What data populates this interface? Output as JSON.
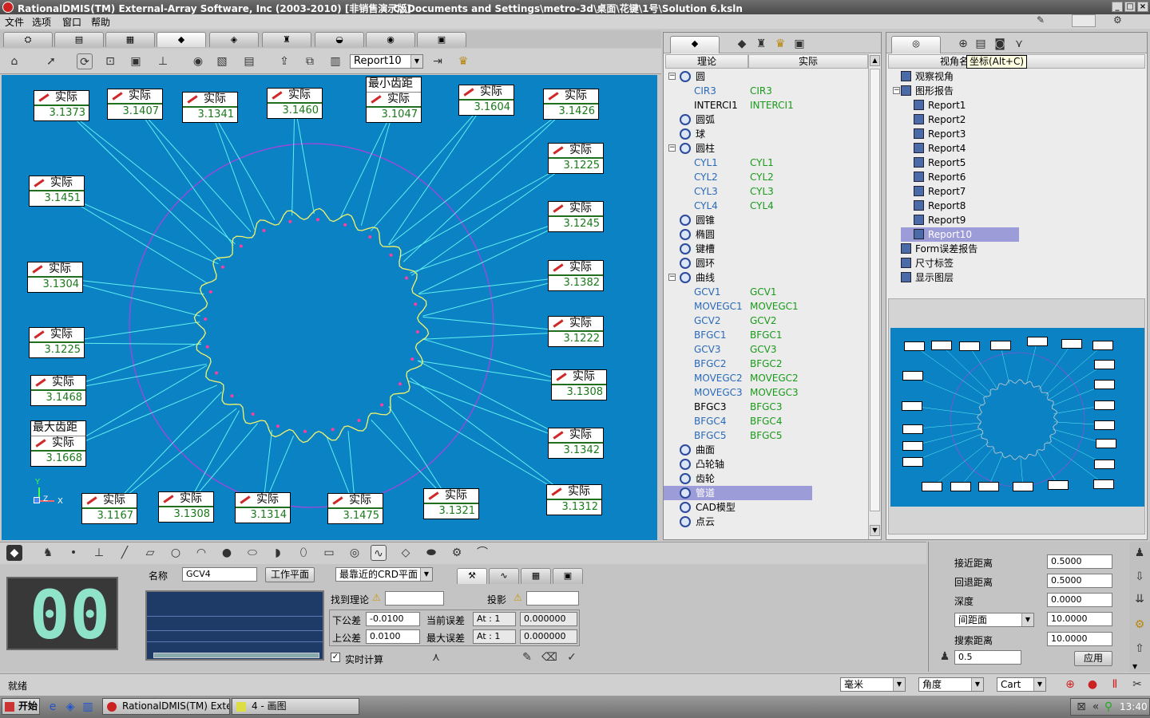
{
  "window": {
    "title": "RationalDMIS(TM) External-Array Software, Inc (2003-2010) [非销售演示版]",
    "path": "C:\\Documents and Settings\\metro-3d\\桌面\\花键\\1号\\Solution 6.ksln"
  },
  "menu": [
    "文件",
    "选项",
    "窗口",
    "帮助"
  ],
  "toolbar": {
    "report_select": "Report10"
  },
  "labels": [
    {
      "h": "实际",
      "v": "3.1373"
    },
    {
      "h": "实际",
      "v": "3.1407"
    },
    {
      "h": "实际",
      "v": "3.1341"
    },
    {
      "h": "实际",
      "v": "3.1460"
    },
    {
      "h0": "最小齿距",
      "h": "实际",
      "v": "3.1047"
    },
    {
      "h": "实际",
      "v": "3.1604"
    },
    {
      "h": "实际",
      "v": "3.1426"
    },
    {
      "h": "实际",
      "v": "3.1225"
    },
    {
      "h": "实际",
      "v": "3.1245"
    },
    {
      "h": "实际",
      "v": "3.1382"
    },
    {
      "h": "实际",
      "v": "3.1222"
    },
    {
      "h": "实际",
      "v": "3.1308"
    },
    {
      "h": "实际",
      "v": "3.1342"
    },
    {
      "h": "实际",
      "v": "3.1312"
    },
    {
      "h": "实际",
      "v": "3.1321"
    },
    {
      "h": "实际",
      "v": "3.1475"
    },
    {
      "h": "实际",
      "v": "3.1314"
    },
    {
      "h": "实际",
      "v": "3.1308"
    },
    {
      "h": "实际",
      "v": "3.1167"
    },
    {
      "h0": "最大齿距",
      "h": "实际",
      "v": "3.1668"
    },
    {
      "h": "实际",
      "v": "3.1468"
    },
    {
      "h": "实际",
      "v": "3.1225"
    },
    {
      "h": "实际",
      "v": "3.1304"
    },
    {
      "h": "实际",
      "v": "3.1451"
    }
  ],
  "axis": {
    "y": "Y",
    "z": "Z",
    "x": "X"
  },
  "tree": {
    "col_theory": "理论",
    "col_actual": "实际",
    "rows": [
      {
        "lvl": 0,
        "exp": "−",
        "a": "圆",
        "b": ""
      },
      {
        "lvl": 1,
        "a": "CIR3",
        "b": "CIR3",
        "dim": true
      },
      {
        "lvl": 1,
        "a": "INTERCI1",
        "b": "INTERCI1"
      },
      {
        "lvl": 0,
        "a": "圆弧",
        "b": ""
      },
      {
        "lvl": 0,
        "a": "球",
        "b": ""
      },
      {
        "lvl": 0,
        "exp": "−",
        "a": "圆柱",
        "b": ""
      },
      {
        "lvl": 1,
        "a": "CYL1",
        "b": "CYL1",
        "dim": true
      },
      {
        "lvl": 1,
        "a": "CYL2",
        "b": "CYL2",
        "dim": true
      },
      {
        "lvl": 1,
        "a": "CYL3",
        "b": "CYL3",
        "dim": true
      },
      {
        "lvl": 1,
        "a": "CYL4",
        "b": "CYL4",
        "dim": true
      },
      {
        "lvl": 0,
        "a": "圆锥",
        "b": ""
      },
      {
        "lvl": 0,
        "a": "椭圆",
        "b": ""
      },
      {
        "lvl": 0,
        "a": "键槽",
        "b": ""
      },
      {
        "lvl": 0,
        "a": "圆环",
        "b": ""
      },
      {
        "lvl": 0,
        "exp": "−",
        "a": "曲线",
        "b": "",
        "dim": true
      },
      {
        "lvl": 1,
        "a": "GCV1",
        "b": "GCV1",
        "dim": true
      },
      {
        "lvl": 1,
        "a": "MOVEGC1",
        "b": "MOVEGC1",
        "dim": true
      },
      {
        "lvl": 1,
        "a": "GCV2",
        "b": "GCV2",
        "dim": true
      },
      {
        "lvl": 1,
        "a": "BFGC1",
        "b": "BFGC1",
        "dim": true
      },
      {
        "lvl": 1,
        "a": "GCV3",
        "b": "GCV3",
        "dim": true
      },
      {
        "lvl": 1,
        "a": "BFGC2",
        "b": "BFGC2",
        "dim": true
      },
      {
        "lvl": 1,
        "a": "MOVEGC2",
        "b": "MOVEGC2",
        "dim": true
      },
      {
        "lvl": 1,
        "a": "MOVEGC3",
        "b": "MOVEGC3",
        "dim": true
      },
      {
        "lvl": 1,
        "a": "BFGC3",
        "b": "BFGC3"
      },
      {
        "lvl": 1,
        "a": "BFGC4",
        "b": "BFGC4",
        "dim": true
      },
      {
        "lvl": 1,
        "a": "BFGC5",
        "b": "BFGC5",
        "dim": true
      },
      {
        "lvl": 0,
        "a": "曲面",
        "b": ""
      },
      {
        "lvl": 0,
        "a": "凸轮轴",
        "b": ""
      },
      {
        "lvl": 0,
        "a": "齿轮",
        "b": ""
      },
      {
        "lvl": 0,
        "a": "管道",
        "b": "",
        "sel": true
      },
      {
        "lvl": 0,
        "a": "CAD模型",
        "b": ""
      },
      {
        "lvl": 0,
        "a": "点云",
        "b": ""
      }
    ]
  },
  "views": {
    "col_name": "视角名称",
    "tooltip": "坐标(Alt+C)",
    "items": [
      {
        "lvl": 0,
        "a": "观察视角"
      },
      {
        "lvl": 0,
        "exp": "−",
        "a": "图形报告"
      },
      {
        "lvl": 1,
        "a": "Report1"
      },
      {
        "lvl": 1,
        "a": "Report2"
      },
      {
        "lvl": 1,
        "a": "Report3"
      },
      {
        "lvl": 1,
        "a": "Report4"
      },
      {
        "lvl": 1,
        "a": "Report5"
      },
      {
        "lvl": 1,
        "a": "Report6"
      },
      {
        "lvl": 1,
        "a": "Report7"
      },
      {
        "lvl": 1,
        "a": "Report8"
      },
      {
        "lvl": 1,
        "a": "Report9"
      },
      {
        "lvl": 1,
        "a": "Report10",
        "sel": true
      },
      {
        "lvl": 0,
        "a": "Form误差报告"
      },
      {
        "lvl": 0,
        "a": "尺寸标签"
      },
      {
        "lvl": 0,
        "a": "显示图层"
      }
    ]
  },
  "bottom": {
    "digits": "00",
    "name_label": "名称",
    "name_value": "GCV4",
    "work_plane": "工作平面",
    "crd_select": "最靠近的CRD平面",
    "find_theory": "找到理论",
    "projection": "投影",
    "lower_tol_label": "下公差",
    "lower_tol": "-0.0100",
    "upper_tol_label": "上公差",
    "upper_tol": "0.0100",
    "cur_err_label": "当前误差",
    "cur_err_at": "At : 1",
    "cur_err": "0.000000",
    "max_err_label": "最大误差",
    "max_err_at": "At : 1",
    "max_err": "0.000000",
    "realtime": "实时计算"
  },
  "params": {
    "approach_label": "接近距离",
    "approach": "0.5000",
    "retract_label": "回退距离",
    "retract": "0.5000",
    "depth_label": "深度",
    "depth": "0.0000",
    "spacing_select": "间距面",
    "spacing": "10.0000",
    "search_label": "搜索距离",
    "search": "10.0000",
    "probe_value": "0.5",
    "apply": "应用"
  },
  "status": {
    "text": "就绪",
    "unit": "毫米",
    "angle": "角度",
    "coord": "Cart"
  },
  "taskbar": {
    "start": "开始",
    "task1": "RationalDMIS(TM) Exter...",
    "task2": "4 - 画图",
    "time": "13:40"
  }
}
